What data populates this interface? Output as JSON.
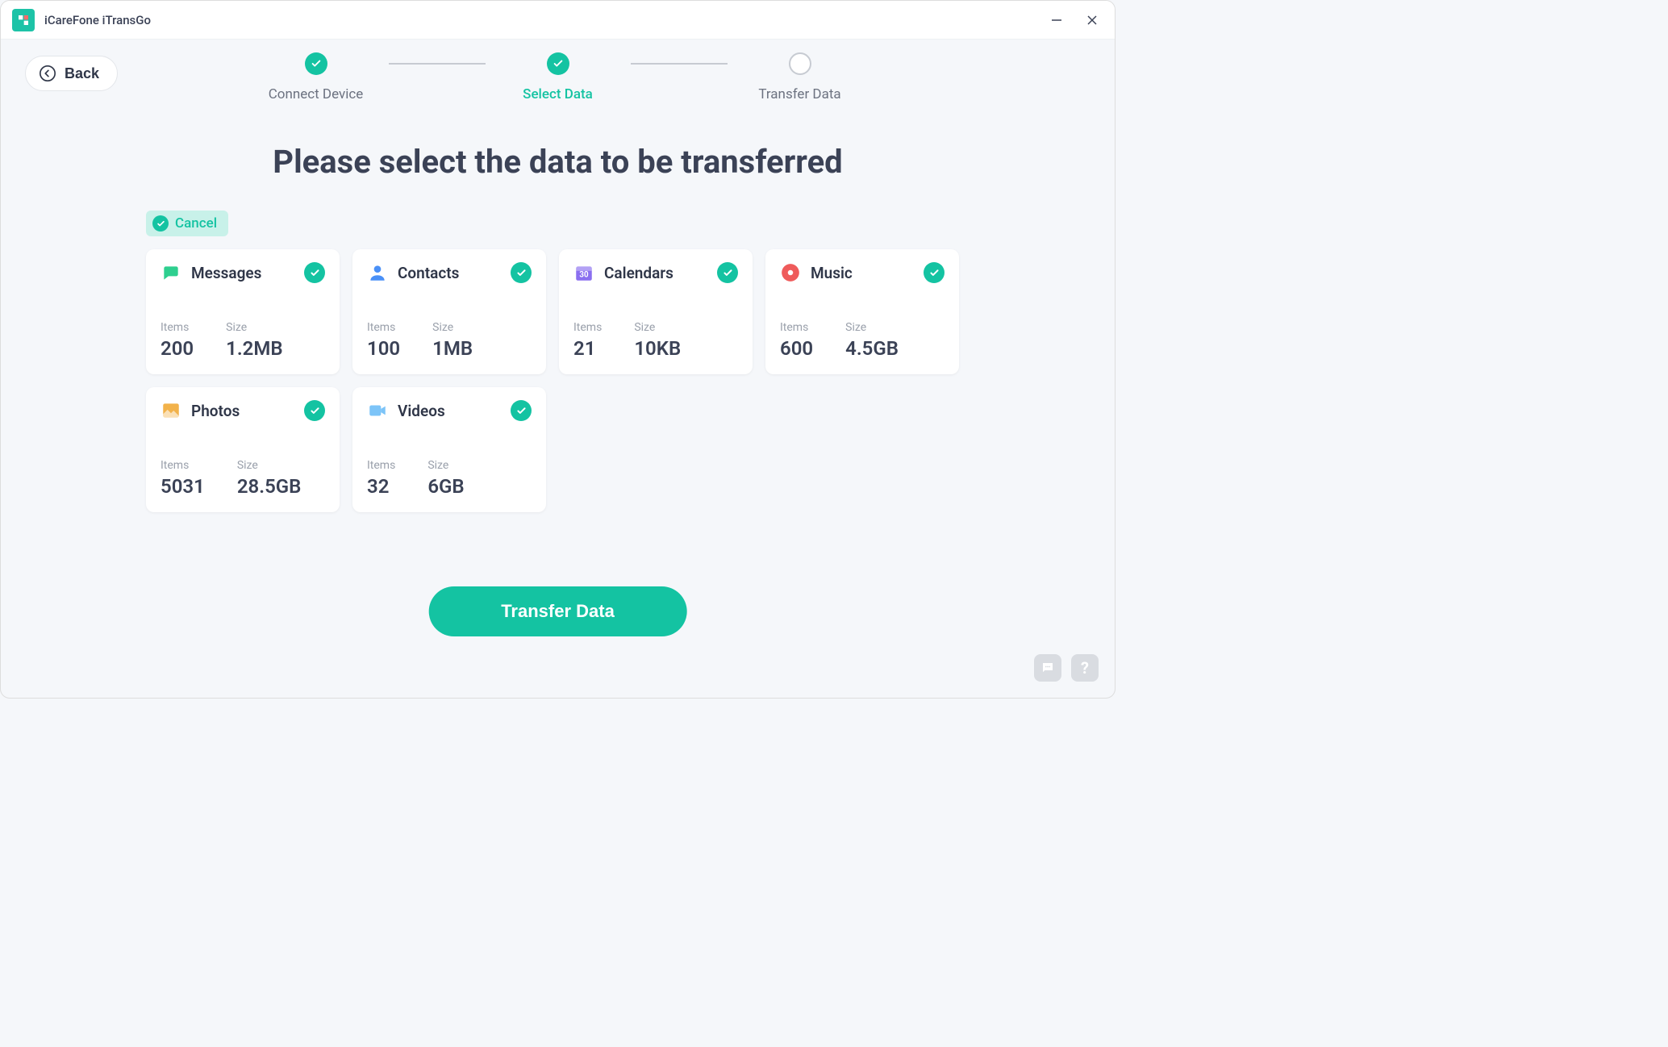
{
  "app": {
    "title": "iCareFone iTransGo"
  },
  "back": {
    "label": "Back"
  },
  "stepper": {
    "steps": [
      {
        "label": "Connect Device",
        "state": "done"
      },
      {
        "label": "Select Data",
        "state": "active"
      },
      {
        "label": "Transfer Data",
        "state": "pending"
      }
    ]
  },
  "heading": "Please select the data to be transferred",
  "cancel": {
    "label": "Cancel"
  },
  "labels": {
    "items": "Items",
    "size": "Size"
  },
  "cards": [
    {
      "id": "messages",
      "title": "Messages",
      "items": "200",
      "size": "1.2MB",
      "icon": "chat",
      "color": "#2ecf8f"
    },
    {
      "id": "contacts",
      "title": "Contacts",
      "items": "100",
      "size": "1MB",
      "icon": "person",
      "color": "#4a90f7"
    },
    {
      "id": "calendars",
      "title": "Calendars",
      "items": "21",
      "size": "10KB",
      "icon": "calendar",
      "color": "#8a6ff0"
    },
    {
      "id": "music",
      "title": "Music",
      "items": "600",
      "size": "4.5GB",
      "icon": "music",
      "color": "#ef5b5b"
    },
    {
      "id": "photos",
      "title": "Photos",
      "items": "5031",
      "size": "28.5GB",
      "icon": "photo",
      "color": "#f2b24a"
    },
    {
      "id": "videos",
      "title": "Videos",
      "items": "32",
      "size": "6GB",
      "icon": "video",
      "color": "#7cc4f8"
    }
  ],
  "transfer": {
    "label": "Transfer Data"
  }
}
